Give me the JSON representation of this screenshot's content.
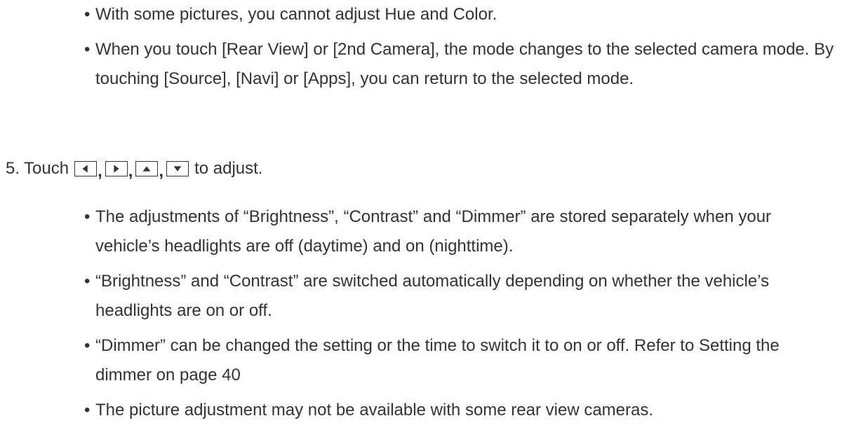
{
  "top_bullets": [
    {
      "text": "With some pictures, you cannot adjust Hue and Color."
    },
    {
      "text": "When you touch [Rear View] or [2nd Camera], the mode changes to the selected camera mode. By touching [Source], [Navi] or [Apps], you can return to the selected mode."
    }
  ],
  "step": {
    "number": "5.",
    "prefix": "Touch",
    "separator": ",",
    "suffix": "to adjust.",
    "buttons": [
      "left-arrow-icon",
      "right-arrow-icon",
      "up-arrow-icon",
      "down-arrow-icon"
    ]
  },
  "bottom_bullets": [
    {
      "text": "The adjustments of “Brightness”, “Contrast” and “Dimmer” are stored separately when your vehicle’s headlights are off (daytime) and on (nighttime)."
    },
    {
      "text": "“Brightness” and “Contrast” are switched automatically depending on whether the vehicle’s headlights are on or off."
    },
    {
      "text": "“Dimmer” can be changed the setting or the time to switch it to on or off. Refer to Setting the dimmer on page 40"
    },
    {
      "text": "The picture adjustment may not be available with some rear view cameras."
    }
  ],
  "bullet_char": "•"
}
